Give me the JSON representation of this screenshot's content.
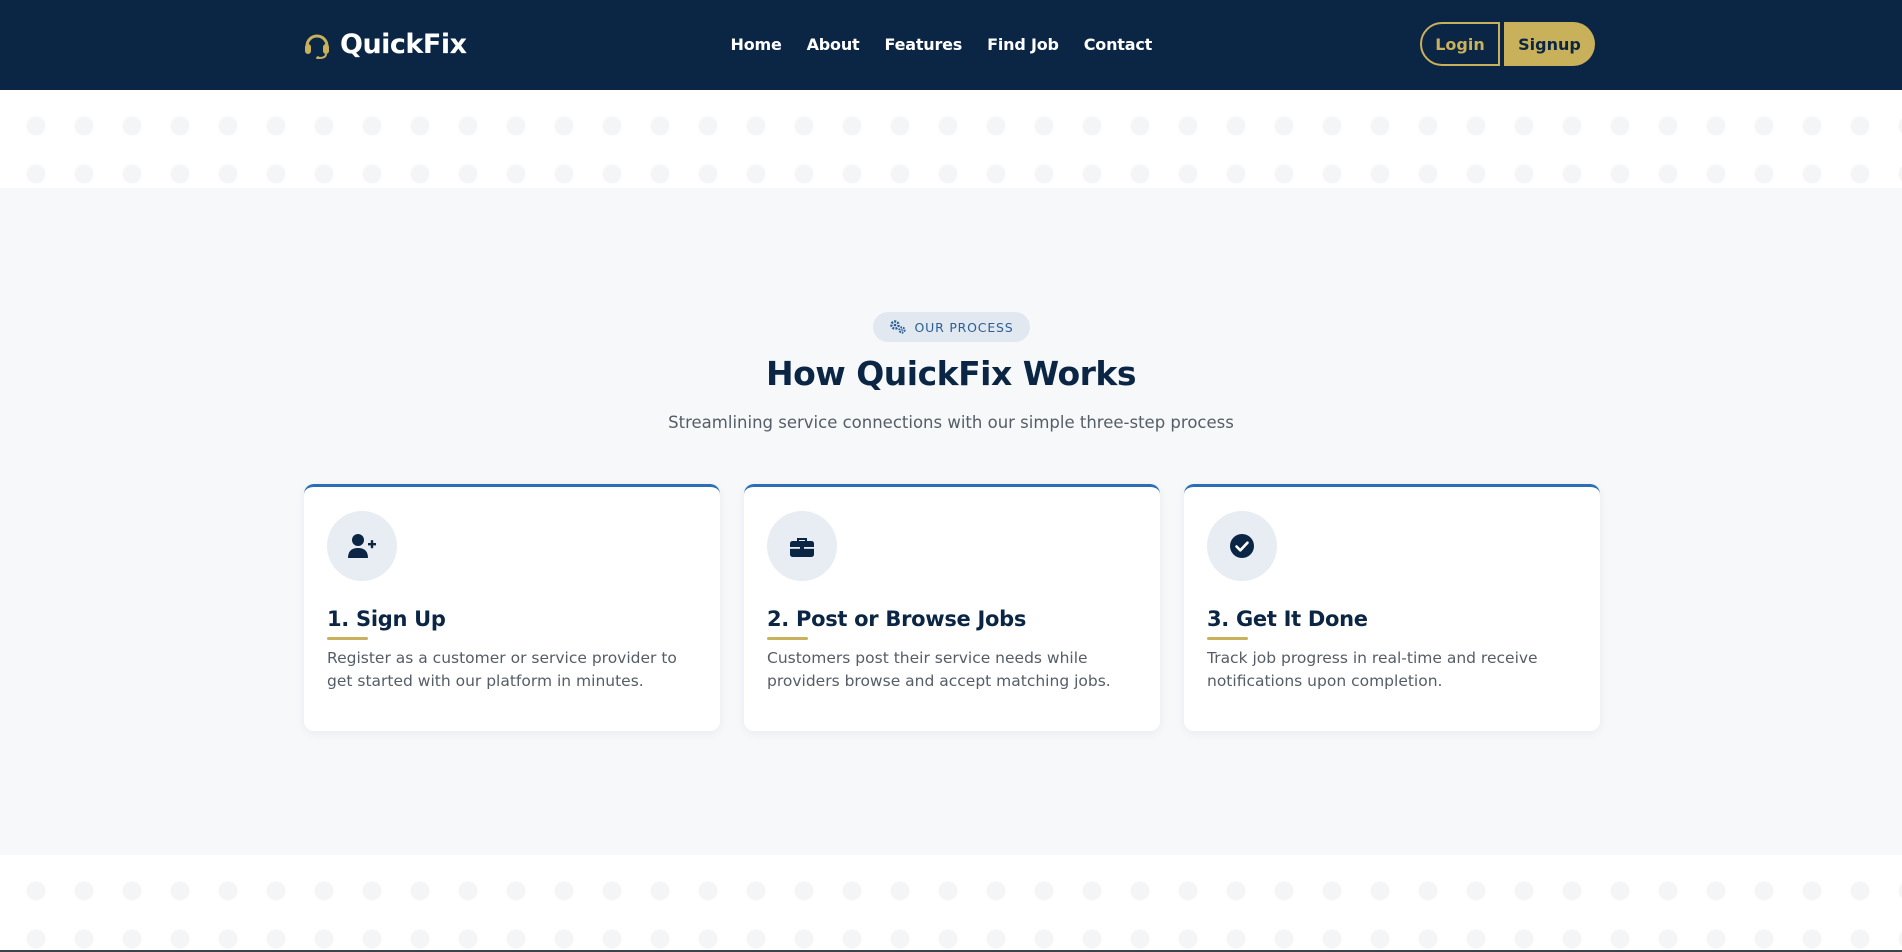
{
  "header": {
    "brand": "QuickFix",
    "brand_icon": "headset-icon",
    "nav": [
      "Home",
      "About",
      "Features",
      "Find Job",
      "Contact"
    ],
    "login_label": "Login",
    "signup_label": "Signup"
  },
  "process": {
    "badge": "OUR PROCESS",
    "badge_icon": "gears-icon",
    "title": "How QuickFix Works",
    "subtitle": "Streamlining service connections with our simple three-step process",
    "steps": [
      {
        "icon": "user-plus-icon",
        "title": "1. Sign Up",
        "text": "Register as a customer or service provider to get started with our platform in minutes."
      },
      {
        "icon": "briefcase-icon",
        "title": "2. Post or Browse Jobs",
        "text": "Customers post their service needs while providers browse and accept matching jobs."
      },
      {
        "icon": "check-circle-icon",
        "title": "3. Get It Done",
        "text": "Track job progress in real-time and receive notifications upon completion."
      }
    ]
  },
  "colors": {
    "navy": "#0b2545",
    "gold": "#c9b05a",
    "accent_blue": "#2a6fb5",
    "section_bg": "#f6f8fa"
  }
}
